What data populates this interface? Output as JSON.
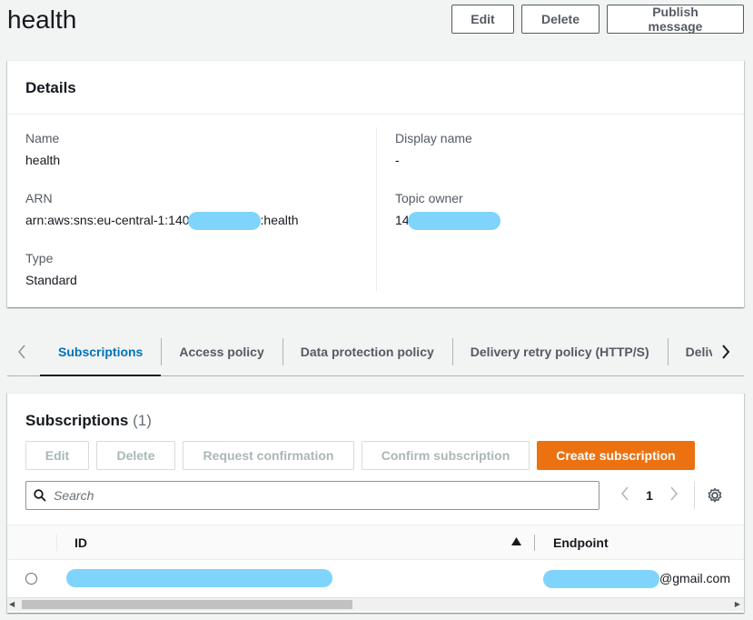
{
  "header": {
    "title": "health",
    "actions": {
      "edit": "Edit",
      "delete": "Delete",
      "publish": "Publish message"
    }
  },
  "details": {
    "heading": "Details",
    "name_label": "Name",
    "name_value": "health",
    "arn_label": "ARN",
    "arn_prefix": "arn:aws:sns:eu-central-1:140",
    "arn_suffix": ":health",
    "type_label": "Type",
    "type_value": "Standard",
    "display_name_label": "Display name",
    "display_name_value": "-",
    "topic_owner_label": "Topic owner",
    "topic_owner_prefix": "14"
  },
  "tabs": [
    {
      "label": "Subscriptions",
      "active": true
    },
    {
      "label": "Access policy"
    },
    {
      "label": "Data protection policy"
    },
    {
      "label": "Delivery retry policy (HTTP/S)"
    },
    {
      "label": "Deliv"
    }
  ],
  "subscriptions": {
    "title": "Subscriptions",
    "count": "(1)",
    "actions": {
      "edit": "Edit",
      "delete": "Delete",
      "request_confirmation": "Request confirmation",
      "confirm_subscription": "Confirm subscription",
      "create_subscription": "Create subscription"
    },
    "search_placeholder": "Search",
    "page": "1",
    "columns": {
      "id": "ID",
      "endpoint": "Endpoint"
    },
    "rows": [
      {
        "endpoint_suffix": "@gmail.com"
      }
    ]
  },
  "colors": {
    "primary": "#ec7211",
    "active_tab": "#0073bb",
    "redaction": "#7fd4fb"
  },
  "icons": [
    "chevron-left-icon",
    "chevron-right-icon",
    "search-icon",
    "gear-icon",
    "sort-ascending-icon"
  ]
}
